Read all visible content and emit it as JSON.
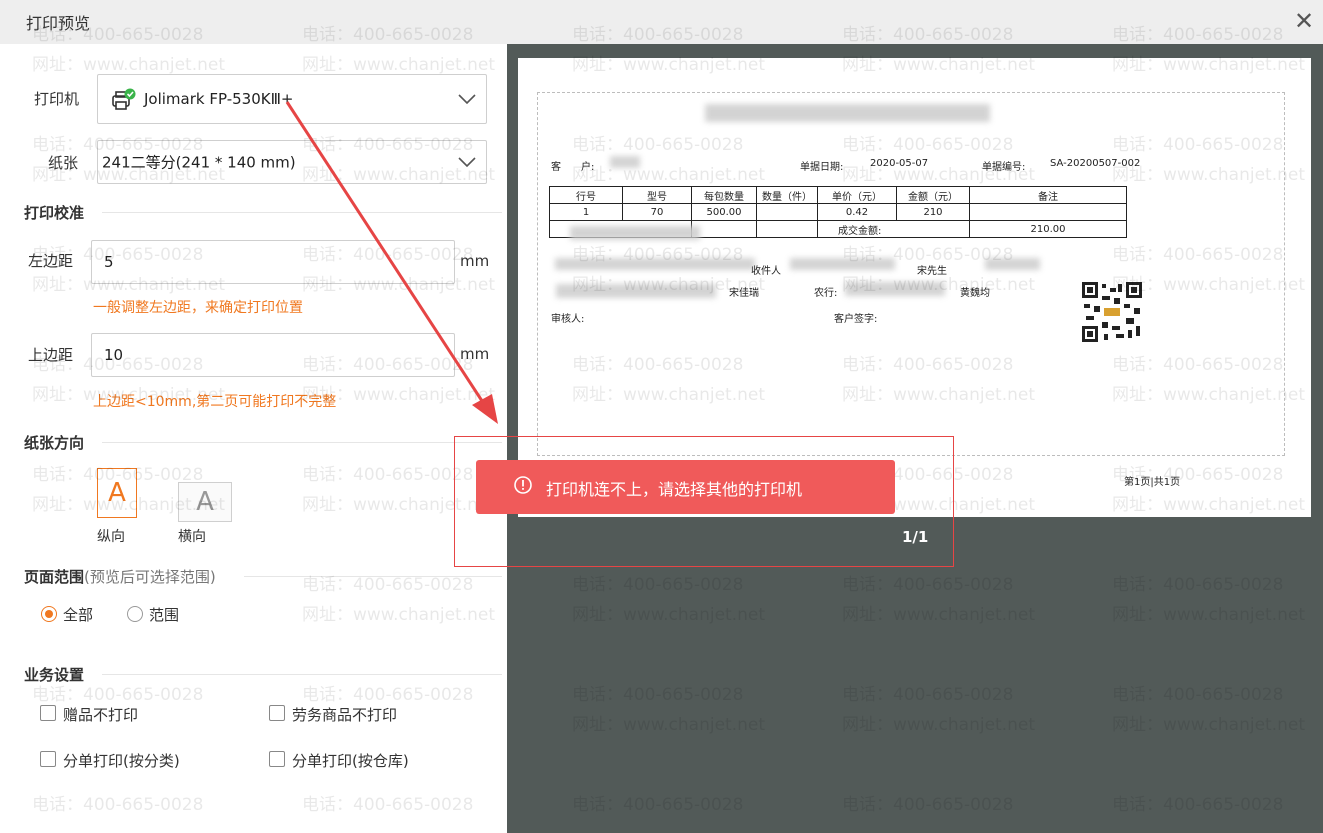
{
  "window": {
    "title": "打印预览",
    "close_glyph": "✕"
  },
  "printer": {
    "label": "打印机",
    "value": "Jolimark FP-530KⅢ+",
    "icon": "printer-ok-icon"
  },
  "paper": {
    "label": "纸张",
    "value": "241二等分(241 * 140  mm)"
  },
  "calibration": {
    "title": "打印校准",
    "left_margin": {
      "label": "左边距",
      "value": "5",
      "unit": "mm",
      "hint": "一般调整左边距，来确定打印位置"
    },
    "top_margin": {
      "label": "上边距",
      "value": "10",
      "unit": "mm",
      "hint": "上边距<10mm,第二页可能打印不完整"
    }
  },
  "orientation": {
    "title": "纸张方向",
    "portrait": {
      "glyph": "A",
      "label": "纵向",
      "selected": true
    },
    "landscape": {
      "glyph": "A",
      "label": "横向",
      "selected": false
    }
  },
  "page_range": {
    "title": "页面范围",
    "subtitle": "(预览后可选择范围)",
    "options": [
      {
        "label": "全部",
        "selected": true
      },
      {
        "label": "范围",
        "selected": false
      }
    ]
  },
  "business": {
    "title": "业务设置",
    "checkboxes": [
      {
        "label": "赠品不打印",
        "checked": false
      },
      {
        "label": "劳务商品不打印",
        "checked": false
      },
      {
        "label": "分单打印(按分类)",
        "checked": false
      },
      {
        "label": "分单打印(按仓库)",
        "checked": false
      }
    ]
  },
  "preview": {
    "customer_label": "客　　户:",
    "date_label": "单据日期:",
    "date_value": "2020-05-07",
    "doc_no_label": "单据编号:",
    "doc_no_value": "SA-20200507-002",
    "table_headers": [
      "行号",
      "型号",
      "每包数量",
      "数量（件）",
      "单价（元）",
      "金额（元）",
      "备注"
    ],
    "table_row": [
      "1",
      "70",
      "500.00",
      "",
      "0.42",
      "210",
      ""
    ],
    "total_label": "成交金额:",
    "total_value": "210.00",
    "receiver_label": "收件人",
    "mr_label": "宋先生",
    "bank_label": "农行:",
    "surname": "宋佳瑞",
    "name2": "黄魏均",
    "auditor_label": "审核人:",
    "customer_sign_label": "客户签字:",
    "page_footer": "第1页|共1页",
    "page_count": "1/1"
  },
  "error": {
    "message": "打印机连不上，请选择其他的打印机",
    "icon": "error-circle-icon"
  },
  "watermark": {
    "phone": "电话：400-665-0028",
    "site": "网址：www.chanjet.net"
  },
  "colors": {
    "accent": "#f07820",
    "error": "#f05a5a",
    "preview_bg": "#525a58",
    "annotation": "#e64545"
  }
}
